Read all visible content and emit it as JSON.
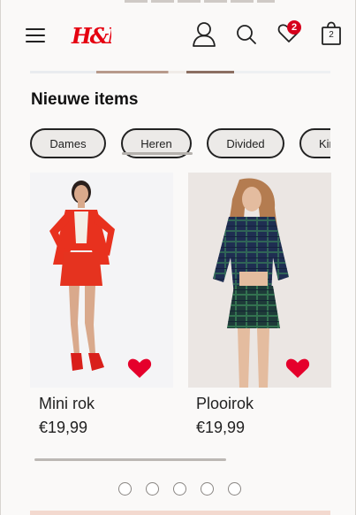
{
  "header": {
    "brand": "H&M",
    "favorites_count": "2",
    "bag_count": "2",
    "brand_color": "#e50010"
  },
  "section": {
    "title": "Nieuwe items"
  },
  "filters": [
    {
      "label": "Dames"
    },
    {
      "label": "Heren"
    },
    {
      "label": "Divided"
    },
    {
      "label": "Kin"
    }
  ],
  "products": [
    {
      "name": "Mini rok",
      "price": "€19,99",
      "favorited": true
    },
    {
      "name": "Plooirok",
      "price": "€19,99",
      "favorited": true
    }
  ],
  "carousel": {
    "dot_count": 5
  },
  "icons": [
    "menu-icon",
    "account-icon",
    "search-icon",
    "heart-icon",
    "shopping-bag-icon"
  ],
  "colors": {
    "accent": "#e50010",
    "heart": "#e5002b",
    "badge": "#d6001c",
    "chip_border": "#222222"
  }
}
